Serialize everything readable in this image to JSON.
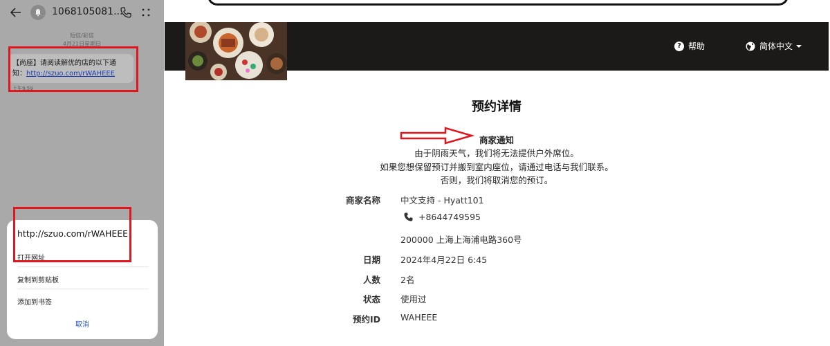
{
  "phone": {
    "contact_name": "1068105081...",
    "msg_type": "短信/彩信",
    "msg_date": "4月21日星期日",
    "sms_prefix": "【尚座】请阅读解优的店的以下通知：",
    "sms_link": "http://szuo.com/rWAHEEE",
    "sms_time": "上午9:59",
    "sheet": {
      "url": "http://szuo.com/rWAHEEE",
      "open_url": "打开网址",
      "copy": "复制到剪贴板",
      "bookmark": "添加到书签",
      "cancel": "取消"
    }
  },
  "web": {
    "nav": {
      "help": "帮助",
      "language": "简体中文"
    },
    "title": "预约详情",
    "notice": {
      "title": "商家通知",
      "line1": "由于阴雨天气，我们将无法提供户外席位。",
      "line2": "如果您想保留预订并搬到室内座位，请通过电话与我们联系。",
      "line3": "否则，我们将取消您的预订。"
    },
    "details": {
      "merchant_label": "商家名称",
      "merchant_name": "中文支持 - Hyatt101",
      "phone": "+8644749595",
      "address": "200000 上海上海浦电路360号",
      "date_label": "日期",
      "date": "2024年4月22日 6:45",
      "people_label": "人数",
      "people": "2名",
      "status_label": "状态",
      "status": "使用过",
      "booking_label": "预约ID",
      "booking_id": "WAHEEE"
    }
  },
  "colors": {
    "highlight": "#e0161f",
    "nav_bg": "#1c1a18",
    "link": "#1a3fb8"
  }
}
